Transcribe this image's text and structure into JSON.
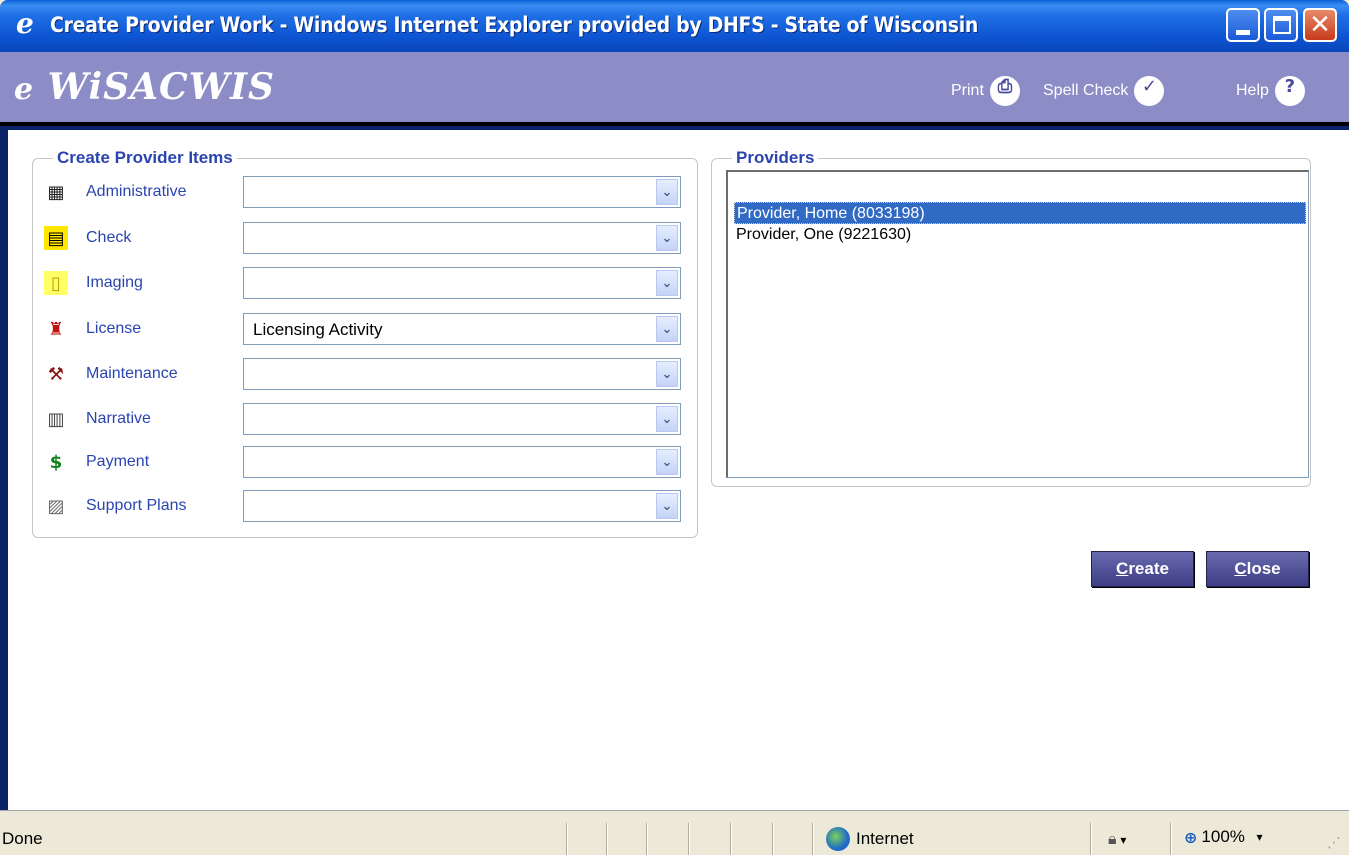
{
  "window": {
    "title": "Create Provider Work - Windows Internet Explorer provided by DHFS - State of Wisconsin"
  },
  "app": {
    "logo_prefix": "e",
    "logo_main": "WiSACWIS",
    "print_label": "Print",
    "spell_label": "Spell Check",
    "help_label": "Help",
    "help_glyph": "?"
  },
  "items_group": {
    "legend": "Create Provider Items",
    "rows": [
      {
        "label": "Administrative",
        "value": "",
        "icon": "building-icon"
      },
      {
        "label": "Check",
        "value": "",
        "icon": "check-document-icon"
      },
      {
        "label": "Imaging",
        "value": "",
        "icon": "clipboard-icon"
      },
      {
        "label": "License",
        "value": "Licensing Activity",
        "icon": "license-stamp-icon"
      },
      {
        "label": "Maintenance",
        "value": "",
        "icon": "maintenance-tools-icon"
      },
      {
        "label": "Narrative",
        "value": "",
        "icon": "narrative-document-icon"
      },
      {
        "label": "Payment",
        "value": "",
        "icon": "dollar-icon"
      },
      {
        "label": "Support Plans",
        "value": "",
        "icon": "support-plans-icon"
      }
    ],
    "dropdown_glyph": "⌄"
  },
  "providers_group": {
    "legend": "Providers",
    "items": [
      {
        "label": "Provider, Home (8033198)",
        "selected": true
      },
      {
        "label": "Provider, One (9221630)",
        "selected": false
      }
    ]
  },
  "actions": {
    "create_label_u": "C",
    "create_label_rest": "reate",
    "close_label_u": "C",
    "close_label_rest": "lose"
  },
  "statusbar": {
    "status": "Done",
    "zone": "Internet",
    "zoom": "100%"
  },
  "colors": {
    "header_bg": "#8c8cc6",
    "label_blue": "#2a44b0",
    "selection": "#316ac5",
    "button": "#4a4a95"
  }
}
